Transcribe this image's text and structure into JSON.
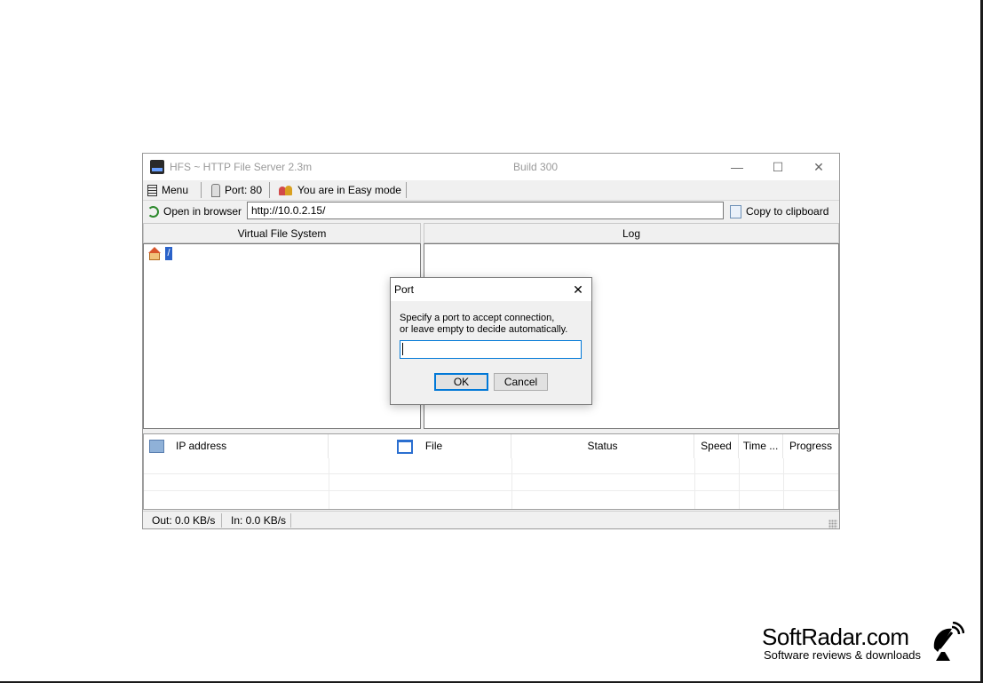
{
  "window": {
    "title": "HFS ~ HTTP File Server 2.3m",
    "build": "Build 300",
    "controls": {
      "minimize": "—",
      "maximize": "☐",
      "close": "✕"
    }
  },
  "toolbar": {
    "menu_label": "Menu",
    "port_label": "Port: 80",
    "mode_label": "You are in Easy mode",
    "open_browser_label": "Open in browser",
    "url_value": "http://10.0.2.15/",
    "copy_label": "Copy to clipboard"
  },
  "panels": {
    "vfs_title": "Virtual File System",
    "log_title": "Log"
  },
  "connections": {
    "columns": [
      "IP address",
      "File",
      "Status",
      "Speed",
      "Time ...",
      "Progress"
    ],
    "rows": []
  },
  "statusbar": {
    "out": "Out: 0.0 KB/s",
    "in": "In: 0.0 KB/s"
  },
  "dialog": {
    "title": "Port",
    "prompt_line1": "Specify a port to accept connection,",
    "prompt_line2": "or leave empty to decide automatically.",
    "input_value": "",
    "ok_label": "OK",
    "cancel_label": "Cancel",
    "close_glyph": "✕"
  },
  "watermark": {
    "title": "SoftRadar.com",
    "subtitle": "Software reviews & downloads"
  }
}
